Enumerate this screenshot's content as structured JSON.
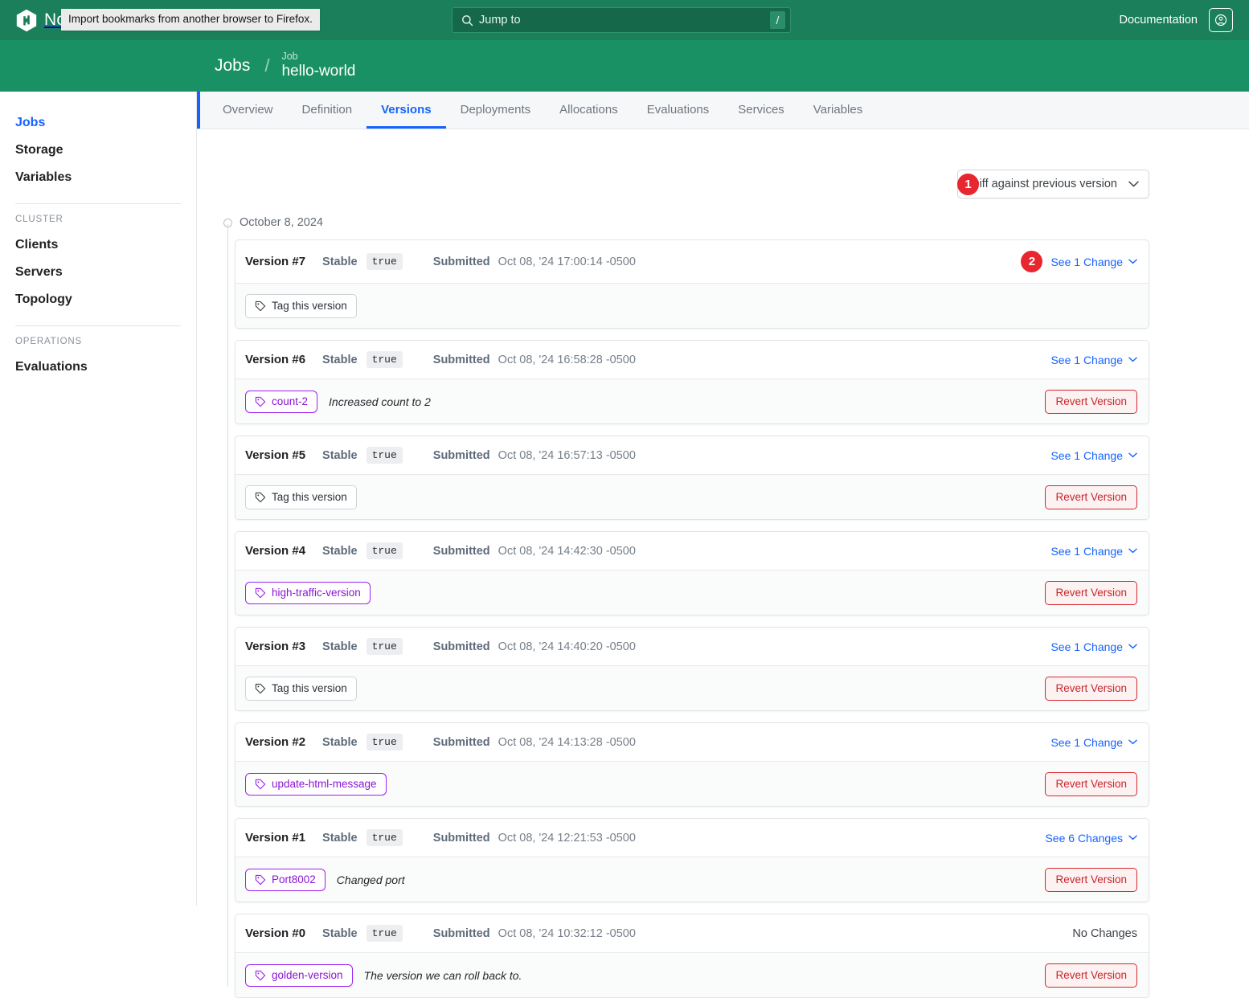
{
  "topbar": {
    "brand_name": "Nomad",
    "brand_icon": "nomad-logo-icon",
    "firefox_tooltip": "Import bookmarks from another browser to Firefox.",
    "search_placeholder": "Jump to",
    "search_icon": "search-icon",
    "search_shortcut": "/",
    "documentation_label": "Documentation",
    "profile_icon": "user-circle-icon",
    "bg_color": "#1a7f5a"
  },
  "breadcrumb": {
    "root_label": "Jobs",
    "separator": "/",
    "leaf_kind": "Job",
    "leaf_name": "hello-world",
    "bg_color": "#1a9164"
  },
  "sidebar": {
    "items": [
      {
        "label": "Jobs",
        "active": true
      },
      {
        "label": "Storage",
        "active": false
      },
      {
        "label": "Variables",
        "active": false
      }
    ],
    "cluster_heading": "CLUSTER",
    "cluster_items": [
      {
        "label": "Clients"
      },
      {
        "label": "Servers"
      },
      {
        "label": "Topology"
      }
    ],
    "operations_heading": "OPERATIONS",
    "operations_items": [
      {
        "label": "Evaluations"
      }
    ],
    "active_color": "#1563ff"
  },
  "tabs": [
    {
      "label": "Overview",
      "active": false
    },
    {
      "label": "Definition",
      "active": false
    },
    {
      "label": "Versions",
      "active": true
    },
    {
      "label": "Deployments",
      "active": false
    },
    {
      "label": "Allocations",
      "active": false
    },
    {
      "label": "Evaluations",
      "active": false
    },
    {
      "label": "Services",
      "active": false
    },
    {
      "label": "Variables",
      "active": false
    }
  ],
  "toolbar": {
    "diff_select_label": "Diff against previous version",
    "diff_chevron_icon": "chevron-down-icon",
    "annotation_1": "1"
  },
  "annotations": {
    "badge_2": "2",
    "badge_color": "#e8262f"
  },
  "timeline": {
    "date_label": "October 8, 2024"
  },
  "labels": {
    "stable": "Stable",
    "submitted": "Submitted",
    "tag_this_version": "Tag this version",
    "revert_version": "Revert Version",
    "no_changes": "No Changes",
    "tag_icon": "tag-icon",
    "chevron_icon": "chevron-down-icon"
  },
  "versions": [
    {
      "number": "Version #7",
      "stable_value": "true",
      "submitted_at": "Oct 08, '24 17:00:14 -0500",
      "changes_label": "See 1 Change",
      "has_changes_link": true,
      "annotated": true,
      "tag": null,
      "tag_note": null,
      "show_tag_button": true,
      "show_revert": false
    },
    {
      "number": "Version #6",
      "stable_value": "true",
      "submitted_at": "Oct 08, '24 16:58:28 -0500",
      "changes_label": "See 1 Change",
      "has_changes_link": true,
      "annotated": false,
      "tag": "count-2",
      "tag_note": "Increased count to 2",
      "show_tag_button": false,
      "show_revert": true
    },
    {
      "number": "Version #5",
      "stable_value": "true",
      "submitted_at": "Oct 08, '24 16:57:13 -0500",
      "changes_label": "See 1 Change",
      "has_changes_link": true,
      "annotated": false,
      "tag": null,
      "tag_note": null,
      "show_tag_button": true,
      "show_revert": true
    },
    {
      "number": "Version #4",
      "stable_value": "true",
      "submitted_at": "Oct 08, '24 14:42:30 -0500",
      "changes_label": "See 1 Change",
      "has_changes_link": true,
      "annotated": false,
      "tag": "high-traffic-version",
      "tag_note": null,
      "show_tag_button": false,
      "show_revert": true
    },
    {
      "number": "Version #3",
      "stable_value": "true",
      "submitted_at": "Oct 08, '24 14:40:20 -0500",
      "changes_label": "See 1 Change",
      "has_changes_link": true,
      "annotated": false,
      "tag": null,
      "tag_note": null,
      "show_tag_button": true,
      "show_revert": true
    },
    {
      "number": "Version #2",
      "stable_value": "true",
      "submitted_at": "Oct 08, '24 14:13:28 -0500",
      "changes_label": "See 1 Change",
      "has_changes_link": true,
      "annotated": false,
      "tag": "update-html-message",
      "tag_note": null,
      "show_tag_button": false,
      "show_revert": true
    },
    {
      "number": "Version #1",
      "stable_value": "true",
      "submitted_at": "Oct 08, '24 12:21:53 -0500",
      "changes_label": "See 6 Changes",
      "has_changes_link": true,
      "annotated": false,
      "tag": "Port8002",
      "tag_note": "Changed port",
      "show_tag_button": false,
      "show_revert": true
    },
    {
      "number": "Version #0",
      "stable_value": "true",
      "submitted_at": "Oct 08, '24 10:32:12 -0500",
      "changes_label": "No Changes",
      "has_changes_link": false,
      "annotated": false,
      "tag": "golden-version",
      "tag_note": "The version we can roll back to.",
      "show_tag_button": false,
      "show_revert": true
    }
  ]
}
